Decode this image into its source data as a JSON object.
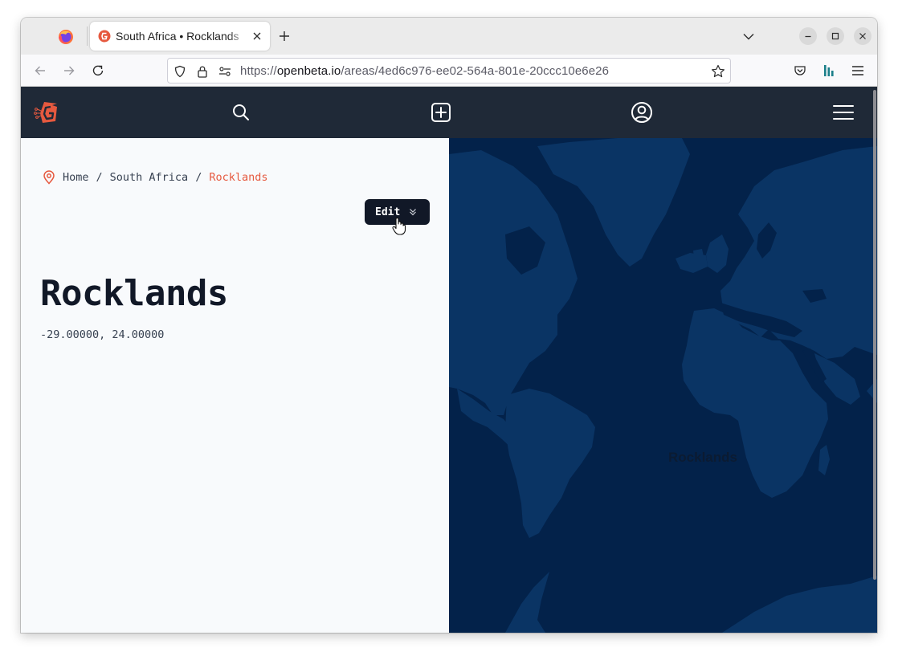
{
  "browser": {
    "tab_title": "South Africa • Rocklands",
    "url_prefix": "https://",
    "url_host": "openbeta.io",
    "url_path": "/areas/4ed6c976-ee02-564a-801e-20ccc10e6e26",
    "icons": [
      "firefox-icon",
      "close-icon",
      "plus-icon",
      "chevron-down-icon",
      "minimize-icon",
      "maximize-icon",
      "close-icon",
      "back-icon",
      "forward-icon",
      "reload-icon",
      "shield-icon",
      "lock-icon",
      "permissions-icon",
      "star-icon",
      "pocket-icon",
      "openbeta-extension-icon",
      "menu-icon"
    ]
  },
  "site": {
    "header_icons": [
      "openbeta-logo",
      "search-icon",
      "add-icon",
      "user-icon",
      "menu-icon"
    ],
    "colors": {
      "header": "#1f2937",
      "accent": "#e6593f",
      "map_ocean": "#03224a",
      "map_land": "#0a3464"
    }
  },
  "breadcrumb": {
    "home": "Home",
    "sep1": "/",
    "country": "South Africa",
    "sep2": "/",
    "current": "Rocklands"
  },
  "edit_button": {
    "label": "Edit"
  },
  "area": {
    "name": "Rocklands",
    "coordinates": "-29.00000, 24.00000"
  },
  "map": {
    "marker_label": "Rocklands"
  }
}
